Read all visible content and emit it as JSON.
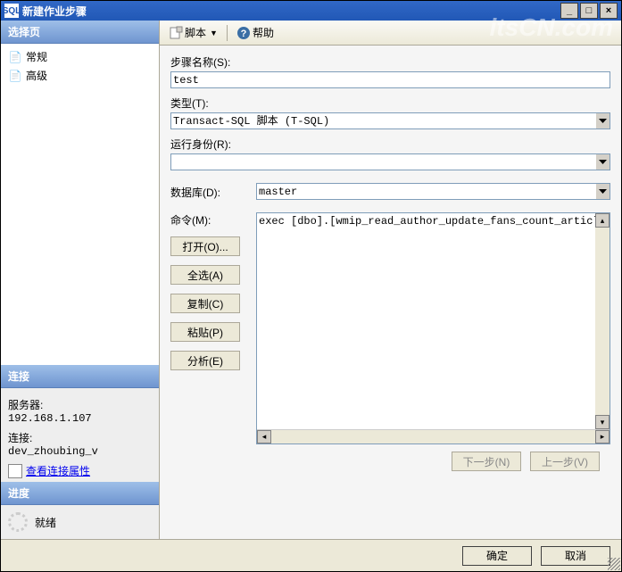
{
  "titlebar": {
    "app_icon": "SQL",
    "title": "新建作业步骤",
    "min": "_",
    "max": "□",
    "close": "×"
  },
  "watermark": "itsCN.com",
  "left": {
    "select_page_hdr": "选择页",
    "tree": {
      "general": "常规",
      "advanced": "高级"
    },
    "connection_hdr": "连接",
    "server_label": "服务器:",
    "server_value": "192.168.1.107",
    "conn_label": "连接:",
    "conn_value": "dev_zhoubing_v",
    "view_conn_props": "查看连接属性",
    "progress_hdr": "进度",
    "ready": "就绪"
  },
  "toolbar": {
    "script": "脚本",
    "help": "帮助"
  },
  "form": {
    "step_name_label": "步骤名称(S):",
    "step_name_value": "test",
    "type_label": "类型(T):",
    "type_value": "Transact-SQL 脚本 (T-SQL)",
    "run_as_label": "运行身份(R):",
    "run_as_value": "",
    "database_label": "数据库(D):",
    "database_value": "master",
    "command_label": "命令(M):",
    "command_value": "exec [dbo].[wmip_read_author_update_fans_count_article_cou",
    "buttons": {
      "open": "打开(O)...",
      "select_all": "全选(A)",
      "copy": "复制(C)",
      "paste": "粘贴(P)",
      "parse": "分析(E)"
    },
    "nav": {
      "next": "下一步(N)",
      "prev": "上一步(V)"
    }
  },
  "footer": {
    "ok": "确定",
    "cancel": "取消"
  }
}
